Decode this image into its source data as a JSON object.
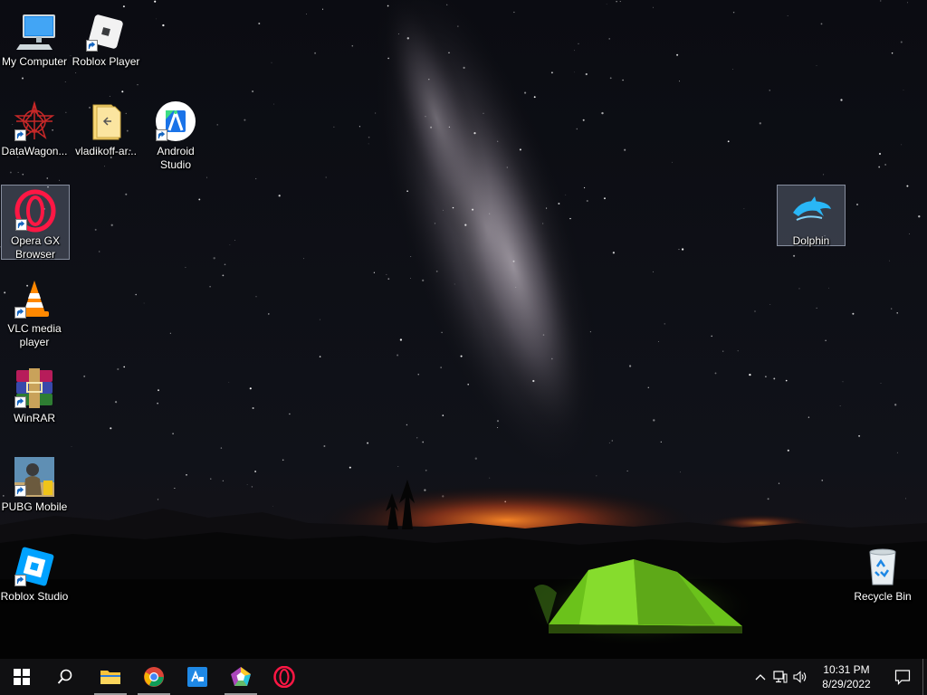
{
  "desktop": {
    "icons": [
      {
        "label": "My Computer",
        "icon": "computer-icon"
      },
      {
        "label": "Roblox Player",
        "icon": "roblox-icon"
      },
      {
        "label": "DataWagon...",
        "icon": "datawagon-icon"
      },
      {
        "label": "vladikoff-ar...",
        "icon": "folder-icon"
      },
      {
        "label": "Android Studio",
        "icon": "android-studio-icon"
      },
      {
        "label": "Opera GX Browser",
        "icon": "opera-gx-icon"
      },
      {
        "label": "Dolphin",
        "icon": "dolphin-icon"
      },
      {
        "label": "VLC media player",
        "icon": "vlc-icon"
      },
      {
        "label": "WinRAR",
        "icon": "winrar-icon"
      },
      {
        "label": "PUBG Mobile",
        "icon": "pubg-icon"
      },
      {
        "label": "Roblox Studio",
        "icon": "roblox-studio-icon"
      },
      {
        "label": "Recycle Bin",
        "icon": "recycle-bin-icon"
      }
    ]
  },
  "taskbar": {
    "apps": [
      {
        "name": "file-explorer",
        "icon": "folder-icon"
      },
      {
        "name": "chrome",
        "icon": "chrome-icon"
      },
      {
        "name": "app-store",
        "icon": "store-icon"
      },
      {
        "name": "pentagon-app",
        "icon": "pentagon-icon"
      },
      {
        "name": "opera",
        "icon": "opera-icon"
      }
    ],
    "clock": {
      "time": "10:31 PM",
      "date": "8/29/2022"
    }
  },
  "colors": {
    "taskbar": "#101012",
    "tent": "#7ed321",
    "horizon_glow": "#ff7a1a",
    "selection": "#a0afc8"
  }
}
